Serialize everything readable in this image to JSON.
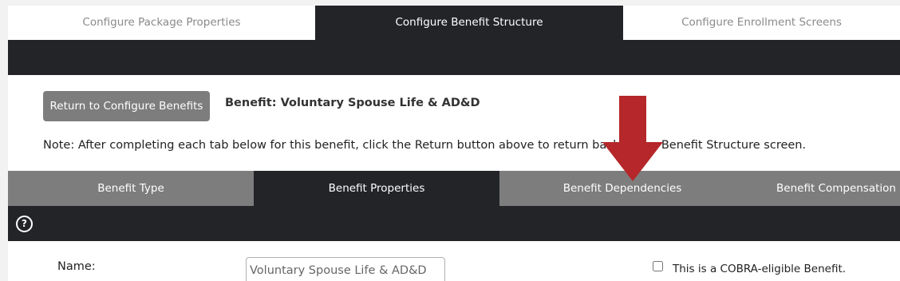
{
  "top_tabs": [
    {
      "label": "Configure Package Properties"
    },
    {
      "label": "Configure Benefit Structure"
    },
    {
      "label": "Configure Enrollment Screens"
    }
  ],
  "return_button_label": "Return to Configure Benefits",
  "benefit_title": "Benefit: Voluntary Spouse Life & AD&D",
  "note": "Note: After completing each tab below for this benefit, click the Return button above to return back to the Benefit Structure screen.",
  "sub_tabs": [
    {
      "label": "Benefit Type"
    },
    {
      "label": "Benefit Properties"
    },
    {
      "label": "Benefit Dependencies"
    },
    {
      "label": "Benefit Compensation"
    }
  ],
  "help_icon": "question-circle-icon",
  "form": {
    "name_label": "Name:",
    "name_value": "Voluntary Spouse Life & AD&D",
    "cobra_checked": false,
    "cobra_label": "This is a COBRA-eligible Benefit."
  },
  "colors": {
    "dark": "#222428",
    "gray": "#7d7d7d",
    "arrow": "#b5272a"
  }
}
